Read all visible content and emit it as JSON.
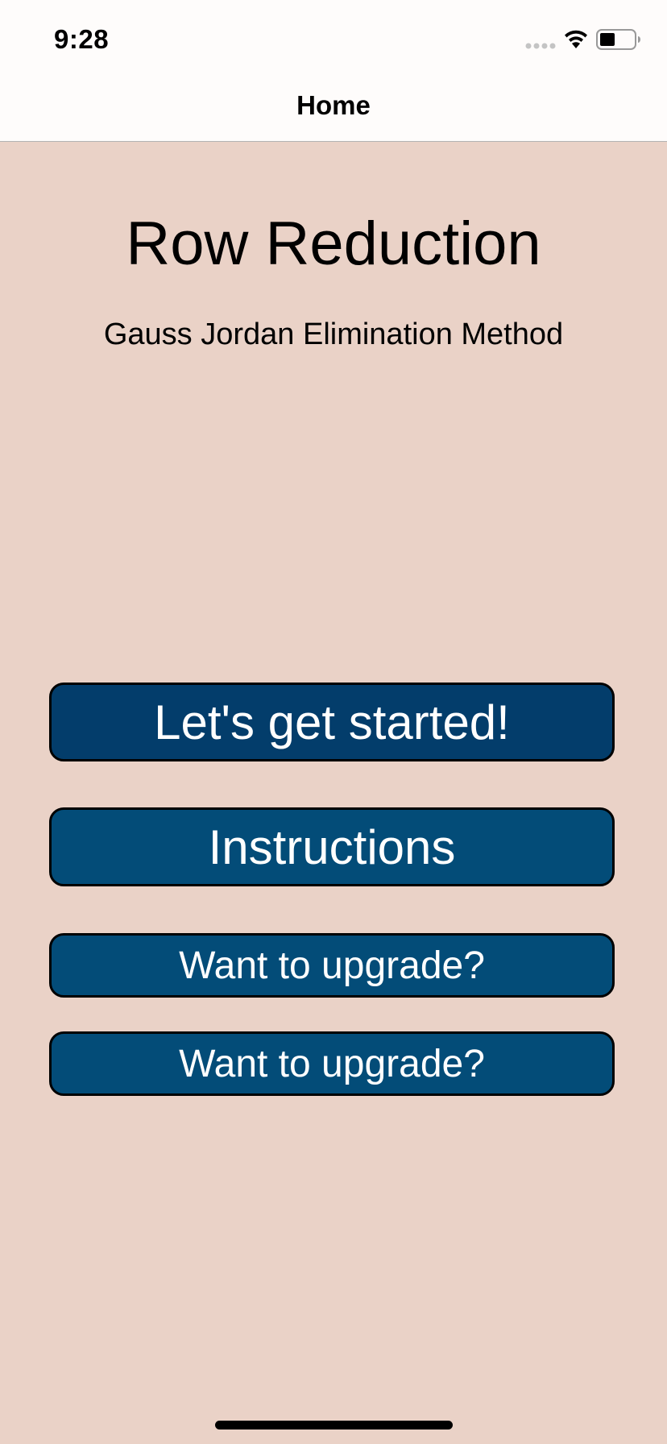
{
  "status_bar": {
    "time": "9:28",
    "icons": [
      "cellular-signal-icon",
      "wifi-icon",
      "battery-icon"
    ]
  },
  "nav": {
    "title": "Home"
  },
  "main": {
    "title": "Row Reduction",
    "subtitle": "Gauss Jordan Elimination Method",
    "buttons": [
      {
        "label": "Let's get started!"
      },
      {
        "label": "Instructions"
      },
      {
        "label": "Want to upgrade?"
      },
      {
        "label": "Want to upgrade?"
      }
    ]
  },
  "colors": {
    "background": "#ead2c7",
    "bar_background": "#fefcfb",
    "button_primary": "#033d6b",
    "button_secondary": "#034c78",
    "button_text": "#ffffff"
  }
}
